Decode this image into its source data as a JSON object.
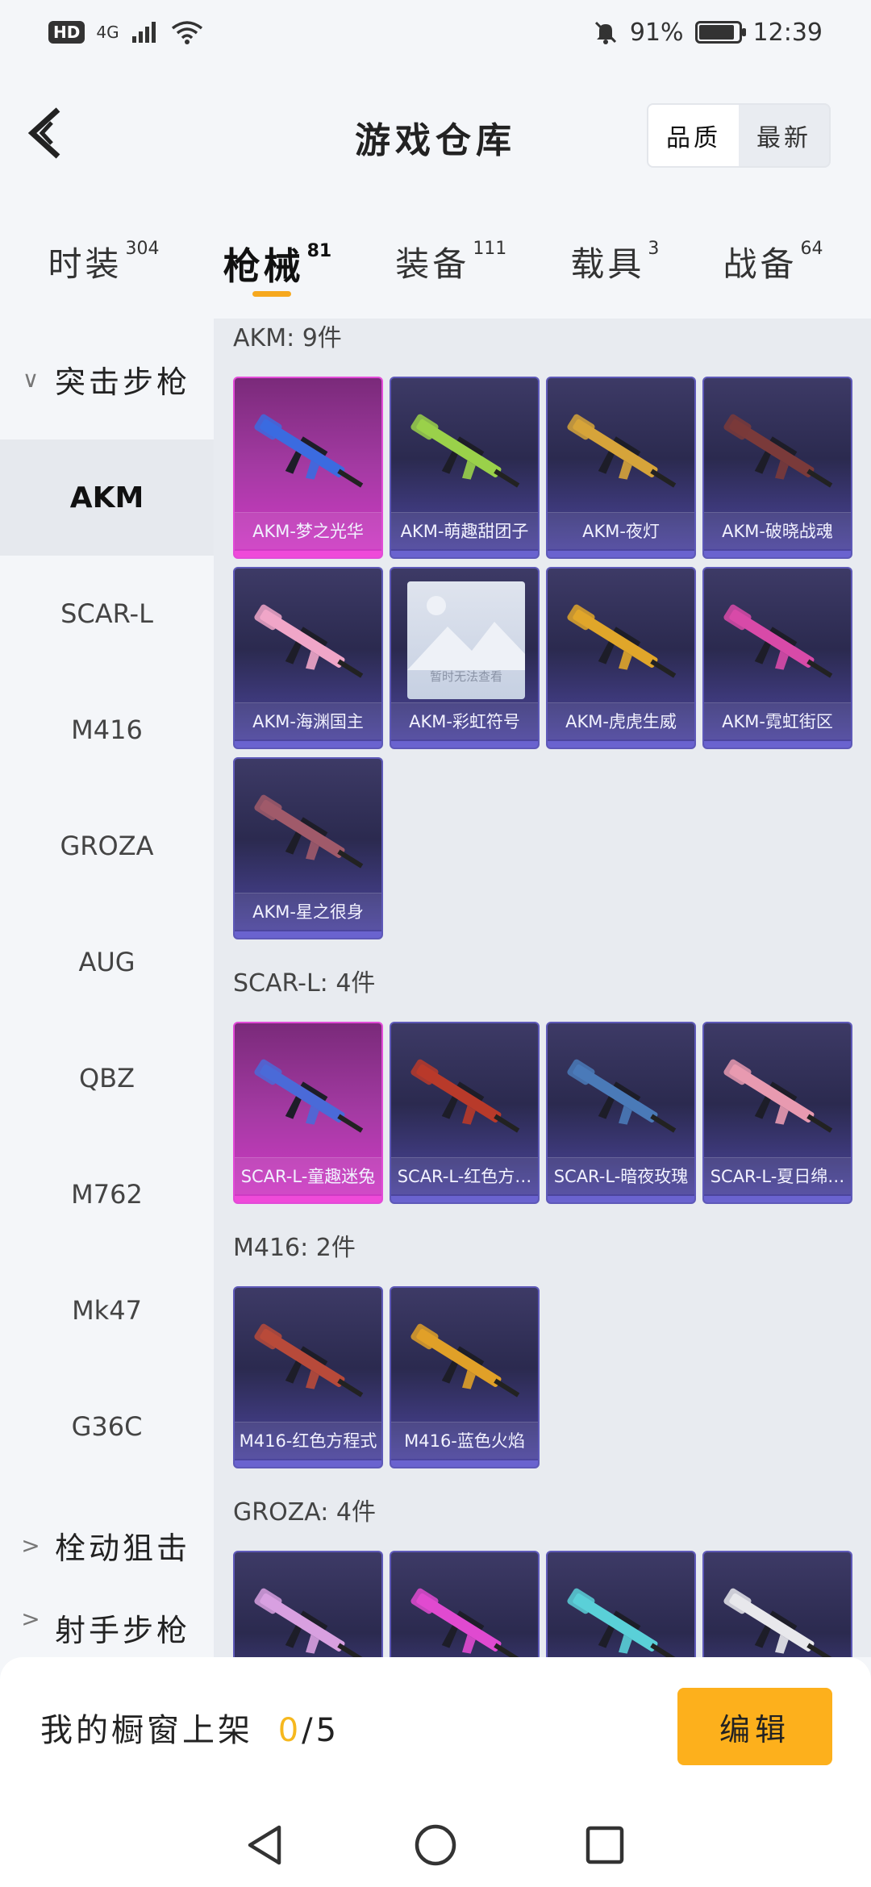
{
  "status_bar": {
    "network_badge": "HD",
    "network_type": "4G",
    "battery_text": "91%",
    "battery_level": 0.91,
    "time": "12:39"
  },
  "header": {
    "title": "游戏仓库",
    "sort_options": [
      "品质",
      "最新"
    ],
    "sort_selected": "品质"
  },
  "tabs": [
    {
      "label": "时装",
      "count": "304"
    },
    {
      "label": "枪械",
      "count": "81"
    },
    {
      "label": "装备",
      "count": "111"
    },
    {
      "label": "载具",
      "count": "3"
    },
    {
      "label": "战备",
      "count": "64"
    }
  ],
  "active_tab": "枪械",
  "sidebar": {
    "group_expanded": "突击步枪",
    "items": [
      "AKM",
      "SCAR-L",
      "M416",
      "GROZA",
      "AUG",
      "QBZ",
      "M762",
      "Mk47",
      "G36C"
    ],
    "active_item": "AKM",
    "group_collapsed_1": "栓动狙击",
    "group_collapsed_2": "射手步枪"
  },
  "sections": [
    {
      "title": "AKM: 9件",
      "items": [
        {
          "label": "AKM-梦之光华",
          "style": "pink",
          "gun_color": "#3b6be0"
        },
        {
          "label": "AKM-萌趣甜团子",
          "style": "purple",
          "gun_color": "#9ad14a"
        },
        {
          "label": "AKM-夜灯",
          "style": "purple",
          "gun_color": "#d6a43a"
        },
        {
          "label": "AKM-破晓战魂",
          "style": "purple",
          "gun_color": "#7a3a3a"
        },
        {
          "label": "AKM-海渊国主",
          "style": "purple",
          "gun_color": "#f0a6c8"
        },
        {
          "label": "AKM-彩虹符号",
          "style": "purple",
          "placeholder": "暂时无法查看"
        },
        {
          "label": "AKM-虎虎生威",
          "style": "purple",
          "gun_color": "#e0a62a"
        },
        {
          "label": "AKM-霓虹街区",
          "style": "purple",
          "gun_color": "#d84aa8"
        },
        {
          "label": "AKM-星之很身",
          "style": "purple",
          "gun_color": "#a05a6a"
        }
      ]
    },
    {
      "title": "SCAR-L: 4件",
      "items": [
        {
          "label": "SCAR-L-童趣迷兔",
          "style": "pink",
          "gun_color": "#4a6ad8"
        },
        {
          "label": "SCAR-L-红色方…",
          "style": "purple",
          "gun_color": "#b83a2a"
        },
        {
          "label": "SCAR-L-暗夜玫瑰",
          "style": "purple",
          "gun_color": "#4a7ab8"
        },
        {
          "label": "SCAR-L-夏日绵…",
          "style": "purple",
          "gun_color": "#e89ab0"
        }
      ]
    },
    {
      "title": "M416: 2件",
      "items": [
        {
          "label": "M416-红色方程式",
          "style": "purple",
          "gun_color": "#b84a3a"
        },
        {
          "label": "M416-蓝色火焰",
          "style": "purple",
          "gun_color": "#e0a028"
        }
      ]
    },
    {
      "title": "GROZA: 4件",
      "items": [
        {
          "label": "",
          "style": "purple",
          "gun_color": "#d8a0e0"
        },
        {
          "label": "",
          "style": "purple",
          "gun_color": "#e04ad0"
        },
        {
          "label": "",
          "style": "purple",
          "gun_color": "#5ad0d8"
        },
        {
          "label": "",
          "style": "purple",
          "gun_color": "#e8e8ec"
        }
      ]
    }
  ],
  "bottom": {
    "showcase_label": "我的橱窗上架",
    "showcase_current": "0",
    "showcase_total": "/5",
    "edit_label": "编辑"
  },
  "colors": {
    "accent": "#f6a81e",
    "edit_button": "#fdb01c",
    "card_pink": "#d13bc6",
    "card_purple": "#4e47a3"
  }
}
